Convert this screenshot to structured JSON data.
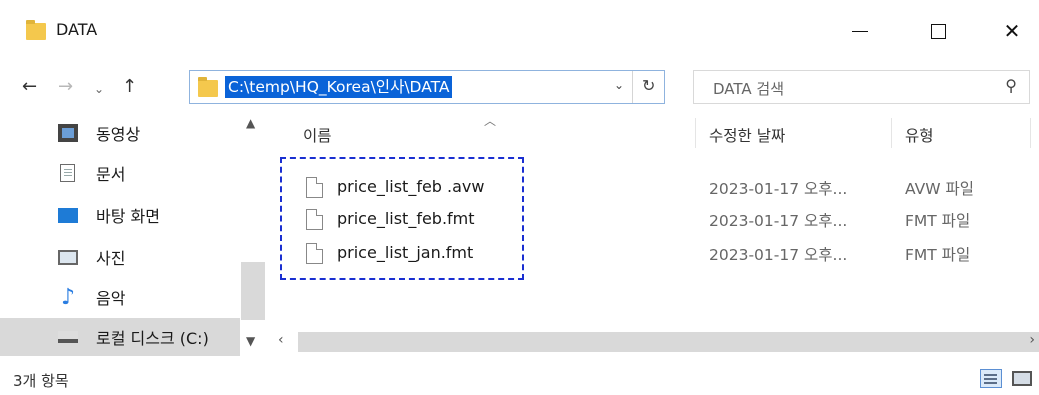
{
  "window": {
    "title": "DATA",
    "minimize_glyph": "—",
    "close_glyph": "✕"
  },
  "nav": {
    "back_glyph": "←",
    "forward_glyph": "→",
    "recent_glyph": "⌄",
    "up_glyph": "↑"
  },
  "address": {
    "path": "C:\\temp\\HQ_Korea\\인사\\DATA",
    "dropdown_glyph": "⌄",
    "refresh_glyph": "↻"
  },
  "search": {
    "placeholder": "DATA 검색",
    "icon_glyph": "⚲"
  },
  "sidebar": {
    "items": [
      {
        "label": "동영상",
        "icon": "video-icon"
      },
      {
        "label": "문서",
        "icon": "document-icon"
      },
      {
        "label": "바탕 화면",
        "icon": "desktop-icon"
      },
      {
        "label": "사진",
        "icon": "picture-icon"
      },
      {
        "label": "음악",
        "icon": "music-icon",
        "glyph": "♪"
      },
      {
        "label": "로컬 디스크 (C:)",
        "icon": "drive-icon"
      }
    ]
  },
  "columns": {
    "name": "이름",
    "date": "수정한 날짜",
    "type": "유형"
  },
  "files": [
    {
      "name": "price_list_feb .avw",
      "date": "2023-01-17 오후...",
      "type": "AVW 파일"
    },
    {
      "name": "price_list_feb.fmt",
      "date": "2023-01-17 오후...",
      "type": "FMT 파일"
    },
    {
      "name": "price_list_jan.fmt",
      "date": "2023-01-17 오후...",
      "type": "FMT 파일"
    }
  ],
  "status": {
    "item_count": "3개 항목"
  },
  "colors": {
    "selection": "#0a63d8",
    "highlight_dashes": "#1a2fd1",
    "sidebar_selected": "#d9d9d9"
  }
}
